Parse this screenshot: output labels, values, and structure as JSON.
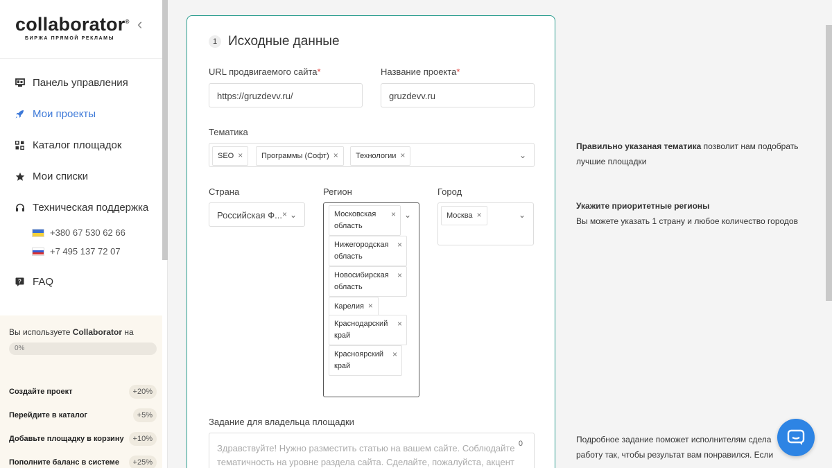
{
  "sidebar": {
    "logo_word": "collaborator",
    "logo_reg": "®",
    "logo_sub": "БИРЖА ПРЯМОЙ РЕКЛАМЫ",
    "collapse_glyph": "‹",
    "items": [
      {
        "label": "Панель управления",
        "icon": "dashboard-icon"
      },
      {
        "label": "Мои проекты",
        "icon": "rocket-icon"
      },
      {
        "label": "Каталог площадок",
        "icon": "catalog-icon"
      },
      {
        "label": "Мои списки",
        "icon": "star-icon"
      },
      {
        "label": "Техническая поддержка",
        "icon": "headset-icon"
      }
    ],
    "phones": [
      {
        "number": "+380 67 530 62 66",
        "flag": "ua-flag-icon"
      },
      {
        "number": "+7 495 137 72 07",
        "flag": "ru-flag-icon"
      }
    ],
    "faq_label": "FAQ",
    "usage_prefix": "Вы используете",
    "usage_brand": "Collaborator",
    "usage_suffix": "на",
    "progress_label": "0%",
    "progress_value": 0,
    "tasks": [
      {
        "label": "Создайте проект",
        "pct": "+20%"
      },
      {
        "label": "Перейдите в каталог",
        "pct": "+5%"
      },
      {
        "label": "Добавьте площадку в корзину",
        "pct": "+10%"
      },
      {
        "label": "Пополните баланс в системе",
        "pct": "+25%"
      }
    ]
  },
  "form": {
    "step_number": "1",
    "step_title": "Исходные данные",
    "url_label": "URL продвигаемого сайта",
    "url_value": "https://gruzdevv.ru/",
    "project_label": "Название проекта",
    "project_value": "gruzdevv.ru",
    "required_mark": "*",
    "topic_label": "Тематика",
    "topics": [
      "SEO",
      "Программы (Софт)",
      "Технологии"
    ],
    "country_label": "Страна",
    "country_value": "Российская Ф...",
    "region_label": "Регион",
    "regions": [
      [
        "Московская",
        "область"
      ],
      [
        "Нижегородская",
        "область"
      ],
      [
        "Новосибирская",
        "область"
      ],
      [
        "Карелия"
      ],
      [
        "Краснодарский",
        "край"
      ],
      [
        "Красноярский",
        "край"
      ]
    ],
    "city_label": "Город",
    "cities": [
      "Москва"
    ],
    "task_label": "Задание для владельца площадки",
    "task_counter": "0",
    "task_placeholder": "Здравствуйте! Нужно разместить статью на вашем сайте. Соблюдайте тематичность на уровне раздела сайта. Сделайте, пожалуйста, акцент на"
  },
  "hints": {
    "topic_bold": "Правильно указаная тематика",
    "topic_rest": " позволит нам подобрать",
    "topic_line2": "лучшие площадки",
    "region_title": "Укажите приоритетные регионы",
    "region_text": "Вы можете указать 1 страну и любое количество городов",
    "task_line1": "Подробное задание поможет исполнителям сдела",
    "task_line2": "работу так, чтобы результат вам понравился. Если"
  },
  "colors": {
    "accent": "#2b9d8f",
    "active_nav": "#3d79d8",
    "required": "#e0413c",
    "chat": "#2d84e4"
  }
}
